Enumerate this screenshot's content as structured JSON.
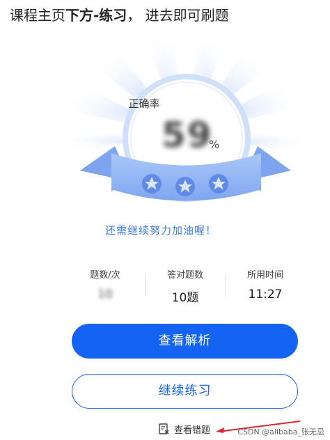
{
  "header": {
    "text_part1": "课程主页",
    "text_bold": "下方-练习",
    "text_part2": "， 进去即可刷题"
  },
  "result": {
    "accuracy_label": "正确率",
    "score": "59",
    "percent_sign": "%",
    "encourage_text": "还需继续努力加油喔！"
  },
  "stats": [
    {
      "label": "题数/次",
      "value": "10"
    },
    {
      "label": "答对题数",
      "value": "10题"
    },
    {
      "label": "所用时间",
      "value": "11:27"
    }
  ],
  "buttons": {
    "view_analysis": "查看解析",
    "continue_practice": "继续练习",
    "view_wrong": "查看错题"
  },
  "watermark": "CSDN @alibaba_张无忌",
  "colors": {
    "accent": "#1463f3",
    "ribbon": "#8fb4f5",
    "encourage_text": "#3d7de8"
  },
  "icons": [
    "star-icon",
    "wrong-questions-icon",
    "red-arrow"
  ]
}
